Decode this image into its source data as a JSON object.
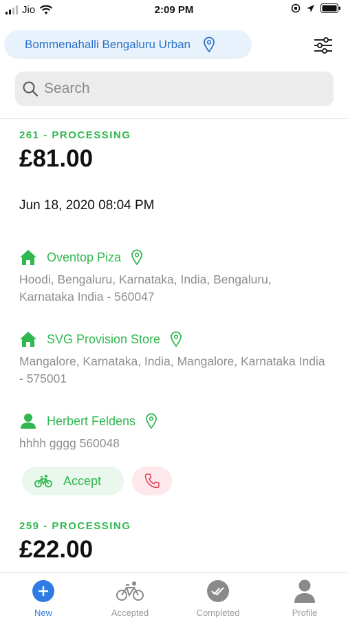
{
  "status_bar": {
    "carrier": "Jio",
    "time": "2:09 PM"
  },
  "location": {
    "label": "Bommenahalli Bengaluru Urban"
  },
  "search": {
    "placeholder": "Search"
  },
  "orders": [
    {
      "status": "261 - PROCESSING",
      "total": "£81.00",
      "date": "Jun 18, 2020 08:04 PM",
      "stops": [
        {
          "name": "Oventop Piza",
          "address": "Hoodi, Bengaluru, Karnataka, India, Bengaluru, Karnataka India - 560047",
          "icon": "home-icon"
        },
        {
          "name": "SVG Provision Store",
          "address": "Mangalore, Karnataka, India, Mangalore, Karnataka India - 575001",
          "icon": "home-icon"
        },
        {
          "name": "Herbert Feldens",
          "address": "hhhh gggg 560048",
          "icon": "person-icon"
        }
      ],
      "accept_label": "Accept"
    },
    {
      "status": "259 - PROCESSING",
      "total": "£22.00"
    }
  ],
  "tabs": [
    {
      "label": "New",
      "icon": "plus-icon",
      "active": true
    },
    {
      "label": "Accepted",
      "icon": "bicycle-icon"
    },
    {
      "label": "Completed",
      "icon": "double-check-icon"
    },
    {
      "label": "Profile",
      "icon": "person-icon"
    }
  ],
  "colors": {
    "accent_green": "#2fb84f",
    "accent_blue": "#2f7be5",
    "call_red": "#e0455a"
  }
}
